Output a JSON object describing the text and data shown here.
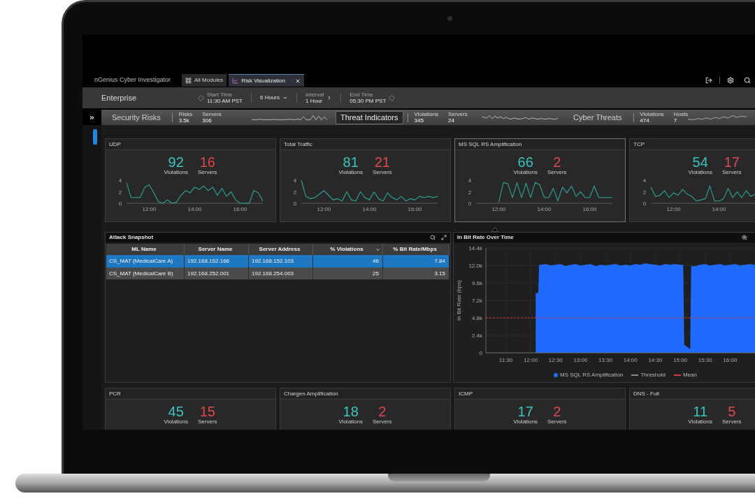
{
  "window": {
    "title": "nGenius Cyber Investigator"
  },
  "tabs": [
    {
      "label": "All Modules",
      "selected": false
    },
    {
      "label": "Risk Visualization",
      "selected": true
    }
  ],
  "header": {
    "scope": "Enterprise",
    "controls": [
      {
        "kind": "range-start",
        "caption": "Start Time",
        "value": "11:30 AM PST"
      },
      {
        "kind": "dropdown",
        "value": "6 Hours"
      },
      {
        "kind": "stepper",
        "caption": "Interval",
        "value": "1 Hour"
      },
      {
        "kind": "range-end",
        "caption": "End Time",
        "value": "05:30 PM PST"
      }
    ]
  },
  "summary": [
    {
      "title": "Security Risks",
      "selected": false,
      "stats": [
        {
          "label": "Risks",
          "value": "3.5k"
        },
        {
          "label": "Servers",
          "value": "306"
        }
      ]
    },
    {
      "title": "Threat Indicators",
      "selected": true,
      "stats": [
        {
          "label": "Violations",
          "value": "345"
        },
        {
          "label": "Servers",
          "value": "24"
        }
      ]
    },
    {
      "title": "Cyber Threats",
      "selected": false,
      "stats": [
        {
          "label": "Violations",
          "value": "474"
        },
        {
          "label": "Hosts",
          "value": "7"
        }
      ]
    }
  ],
  "cards": [
    {
      "title": "UDP",
      "selected": false,
      "stats": [
        {
          "kind": "violations",
          "value": "92",
          "label": "Violations"
        },
        {
          "kind": "servers",
          "value": "16",
          "label": "Servers"
        }
      ],
      "chart_data": {
        "type": "line",
        "xlim": [
          11,
          17
        ],
        "ylim": [
          0,
          4
        ],
        "xticks": [
          {
            "value": 12,
            "label": "12:00"
          },
          {
            "value": 14,
            "label": "14:00"
          },
          {
            "value": 16,
            "label": "16:00"
          }
        ],
        "yticks": [
          0,
          2,
          4
        ],
        "x": [
          11,
          11.2,
          11.4,
          11.6,
          11.8,
          12,
          12.2,
          12.4,
          12.6,
          12.8,
          13,
          13.2,
          13.4,
          13.6,
          13.8,
          14,
          14.2,
          14.4,
          14.6,
          14.8,
          15,
          15.2,
          15.4,
          15.6,
          15.8,
          16,
          16.2,
          16.4,
          16.6,
          16.8,
          17
        ],
        "values": [
          3.6,
          1.0,
          1.0,
          1.0,
          2.8,
          3.2,
          1.8,
          0.3,
          0,
          0.6,
          0,
          0.2,
          1.4,
          2.2,
          1.8,
          2.8,
          2.4,
          3.0,
          2.2,
          2.8,
          1.4,
          2.6,
          1.2,
          2.0,
          0.6,
          0,
          0,
          0,
          2.2,
          1.8,
          0.4
        ]
      }
    },
    {
      "title": "Total Traffic",
      "selected": false,
      "stats": [
        {
          "kind": "violations",
          "value": "81",
          "label": "Violations"
        },
        {
          "kind": "servers",
          "value": "21",
          "label": "Servers"
        }
      ],
      "chart_data": {
        "type": "line",
        "xlim": [
          11,
          17
        ],
        "ylim": [
          0,
          4
        ],
        "xticks": [
          {
            "value": 12,
            "label": "12:00"
          },
          {
            "value": 14,
            "label": "14:00"
          },
          {
            "value": 16,
            "label": "16:00"
          }
        ],
        "yticks": [
          0,
          2,
          4
        ],
        "x": [
          11,
          11.2,
          11.4,
          11.6,
          11.8,
          12,
          12.2,
          12.4,
          12.6,
          12.8,
          13,
          13.2,
          13.4,
          13.6,
          13.8,
          14,
          14.2,
          14.4,
          14.6,
          14.8,
          15,
          15.2,
          15.4,
          15.6,
          15.8,
          16,
          16.2,
          16.4,
          16.6,
          16.8,
          17
        ],
        "values": [
          4.0,
          1.2,
          0.8,
          1.0,
          1.6,
          2.2,
          1.4,
          0.6,
          0.8,
          0.4,
          2.0,
          0.6,
          0.4,
          2.0,
          1.0,
          0.6,
          2.0,
          0.8,
          0.4,
          1.8,
          1.0,
          0.6,
          1.2,
          0.4,
          0.8,
          0.6,
          1.2,
          1.0,
          1.2,
          1.0,
          1.2
        ]
      }
    },
    {
      "title": "MS SQL RS Amplification",
      "selected": true,
      "stats": [
        {
          "kind": "violations",
          "value": "66",
          "label": "Violations"
        },
        {
          "kind": "servers",
          "value": "2",
          "label": "Servers"
        }
      ],
      "chart_data": {
        "type": "line",
        "xlim": [
          11,
          17
        ],
        "ylim": [
          0,
          4
        ],
        "xticks": [
          {
            "value": 12,
            "label": "12:00"
          },
          {
            "value": 14,
            "label": "14:00"
          },
          {
            "value": 16,
            "label": "16:00"
          }
        ],
        "yticks": [
          0,
          2,
          4
        ],
        "x": [
          12,
          12.2,
          12.4,
          12.6,
          12.8,
          13,
          13.2,
          13.4,
          13.6,
          13.8,
          14,
          14.2,
          14.4,
          14.6,
          14.8,
          15,
          15.2,
          15.4,
          15.6,
          15.8,
          16,
          16.2,
          16.4,
          16.6,
          16.8,
          17
        ],
        "values": [
          0.2,
          3.6,
          3.4,
          1.0,
          3.6,
          1.0,
          3.5,
          1.0,
          3.6,
          3.2,
          1.0,
          1.0,
          2.6,
          0.4,
          2.8,
          1.8,
          3.0,
          1.2,
          2.0,
          1.0,
          1.0,
          3.0,
          1.0,
          1.0,
          1.0,
          1.0
        ]
      }
    },
    {
      "title": "TCP",
      "selected": false,
      "stats": [
        {
          "kind": "violations",
          "value": "54",
          "label": "Violations"
        },
        {
          "kind": "servers",
          "value": "17",
          "label": "Servers"
        }
      ],
      "chart_data": {
        "type": "line",
        "xlim": [
          11,
          17
        ],
        "ylim": [
          0,
          4
        ],
        "xticks": [
          {
            "value": 12,
            "label": "12:00"
          },
          {
            "value": 14,
            "label": "14:00"
          }
        ],
        "yticks": [
          0,
          2,
          4
        ],
        "x": [
          11,
          11.2,
          11.4,
          11.6,
          11.8,
          12,
          12.2,
          12.4,
          12.6,
          12.8,
          13,
          13.2,
          13.4,
          13.6,
          13.8,
          14,
          14.2,
          14.4,
          14.6,
          14.8,
          15,
          15.2,
          15.4,
          15.6
        ],
        "values": [
          2.8,
          1.2,
          1.4,
          2.2,
          1.0,
          1.8,
          1.4,
          2.4,
          1.6,
          1.2,
          0.4,
          0.6,
          0.8,
          3.0,
          0.4,
          0.4,
          0.8,
          2.6,
          1.0,
          2.0,
          1.0,
          2.2,
          1.2,
          1.6
        ]
      }
    }
  ],
  "table": {
    "title": "Attack Snapshot",
    "columns": [
      {
        "label": "ML Name",
        "sorted": false
      },
      {
        "label": "Server Name",
        "sorted": false
      },
      {
        "label": "Server Address",
        "sorted": false
      },
      {
        "label": "% Violations",
        "sorted": true
      },
      {
        "label": "% Bit Rate/Mbps",
        "sorted": false
      }
    ],
    "rows": [
      {
        "selected": true,
        "cells": [
          "CS_MAT (MedicalCare A)",
          "192.168.152.166",
          "192.168.152.103",
          "46",
          "7.84"
        ]
      },
      {
        "selected": false,
        "cells": [
          "CS_MAT (MedicalCare B)",
          "192.168.252.001",
          "192.168.254.003",
          "25",
          "3.15"
        ]
      }
    ]
  },
  "chart_panel": {
    "title": "In Bit Rate Over Time",
    "chart_data": {
      "type": "area",
      "ylabel": "In Bit Rate (bps)",
      "grid": true,
      "xlim": [
        11.1,
        16.5
      ],
      "ylim": [
        0,
        14400
      ],
      "xticks": [
        {
          "value": 11.5,
          "label": "11:30"
        },
        {
          "value": 12,
          "label": "12:00"
        },
        {
          "value": 12.5,
          "label": "12:30"
        },
        {
          "value": 13,
          "label": "13:00"
        },
        {
          "value": 13.5,
          "label": "13:30"
        },
        {
          "value": 14,
          "label": "14:00"
        },
        {
          "value": 14.5,
          "label": "14:30"
        },
        {
          "value": 15,
          "label": "15:00"
        },
        {
          "value": 15.5,
          "label": "15:30"
        },
        {
          "value": 16,
          "label": "16:00"
        }
      ],
      "yticks": [
        {
          "value": 0,
          "label": "0"
        },
        {
          "value": 2400,
          "label": "2.4k"
        },
        {
          "value": 4800,
          "label": "4.8k"
        },
        {
          "value": 7200,
          "label": "7.2k"
        },
        {
          "value": 9600,
          "label": "9.6k"
        },
        {
          "value": 12000,
          "label": "12.0k"
        },
        {
          "value": 14400,
          "label": "14.4k"
        }
      ],
      "x": [
        12.1,
        12.15,
        12.17,
        12.2,
        12.3,
        12.4,
        12.5,
        12.6,
        12.7,
        12.8,
        12.9,
        13,
        13.1,
        13.2,
        13.3,
        13.4,
        13.5,
        13.6,
        13.7,
        13.8,
        13.9,
        14,
        14.1,
        14.2,
        14.3,
        14.4,
        14.5,
        14.6,
        14.7,
        14.8,
        14.9,
        15,
        15.06,
        15.08,
        15.2,
        15.22,
        15.3,
        15.4,
        15.5,
        15.6,
        15.7,
        15.8,
        15.9,
        16,
        16.1,
        16.2,
        16.3,
        16.4,
        16.5
      ],
      "series": [
        {
          "name": "MS SQL RS Amplification",
          "color": "#1f6bff",
          "values": [
            8200,
            8200,
            12100,
            12100,
            12200,
            12000,
            12100,
            12200,
            11900,
            12100,
            12200,
            12000,
            12100,
            12200,
            11900,
            12100,
            12000,
            12100,
            12200,
            12000,
            12100,
            12000,
            12200,
            12100,
            12300,
            12200,
            12100,
            12000,
            12200,
            12100,
            12200,
            12100,
            12100,
            1100,
            500,
            11900,
            11900,
            12100,
            12200,
            12000,
            12100,
            12200,
            12000,
            12100,
            12200,
            12000,
            12100,
            12200,
            12100
          ]
        }
      ],
      "ref_lines": [
        {
          "axis": "y",
          "value": 4800,
          "label": "Mean",
          "color": "#d63a3a"
        }
      ]
    },
    "legend_note": {
      "label": "Threshold",
      "color": "#8c8c8c"
    }
  },
  "lower_cards": [
    {
      "title": "PCR",
      "selected": false,
      "stats": [
        {
          "kind": "violations",
          "value": "45",
          "label": "Violations"
        },
        {
          "kind": "servers",
          "value": "15",
          "label": "Servers"
        }
      ]
    },
    {
      "title": "Chargen Amplification",
      "selected": false,
      "stats": [
        {
          "kind": "violations",
          "value": "18",
          "label": "Violations"
        },
        {
          "kind": "servers",
          "value": "2",
          "label": "Servers"
        }
      ]
    },
    {
      "title": "ICMP",
      "selected": false,
      "stats": [
        {
          "kind": "violations",
          "value": "17",
          "label": "Violations"
        },
        {
          "kind": "servers",
          "value": "2",
          "label": "Servers"
        }
      ]
    },
    {
      "title": "DNS - Full",
      "selected": false,
      "stats": [
        {
          "kind": "violations",
          "value": "11",
          "label": "Violations"
        },
        {
          "kind": "servers",
          "value": "5",
          "label": "Servers"
        }
      ]
    }
  ]
}
